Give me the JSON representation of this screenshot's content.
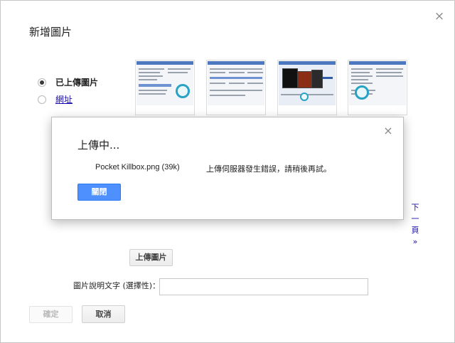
{
  "dialog": {
    "title": "新增圖片",
    "close_glyph": "×",
    "source_options": [
      {
        "label": "已上傳圖片",
        "selected": true
      },
      {
        "label": "網址",
        "selected": false
      }
    ],
    "thumbnails": [
      {
        "name": "screenshot-app-window"
      },
      {
        "name": "screenshot-table-window"
      },
      {
        "name": "screenshot-monitors"
      },
      {
        "name": "screenshot-list-window"
      }
    ],
    "next_page": {
      "chars": [
        "下",
        "一",
        "頁",
        "»"
      ]
    },
    "upload_button": "上傳圖片",
    "caption_label": "圖片說明文字 (選擇性)：",
    "caption_value": "",
    "ok_button": "確定",
    "cancel_button": "取消"
  },
  "modal": {
    "title": "上傳中...",
    "close_glyph": "×",
    "file_name": "Pocket Killbox.png (39k)",
    "error_message": "上傳伺服器發生錯誤，請稍後再試。",
    "close_button": "關閉"
  },
  "colors": {
    "accent_blue": "#4d90fe",
    "link_blue": "#1a0dab"
  },
  "icons": {
    "dialog_close": "close-icon",
    "modal_close": "close-icon"
  }
}
